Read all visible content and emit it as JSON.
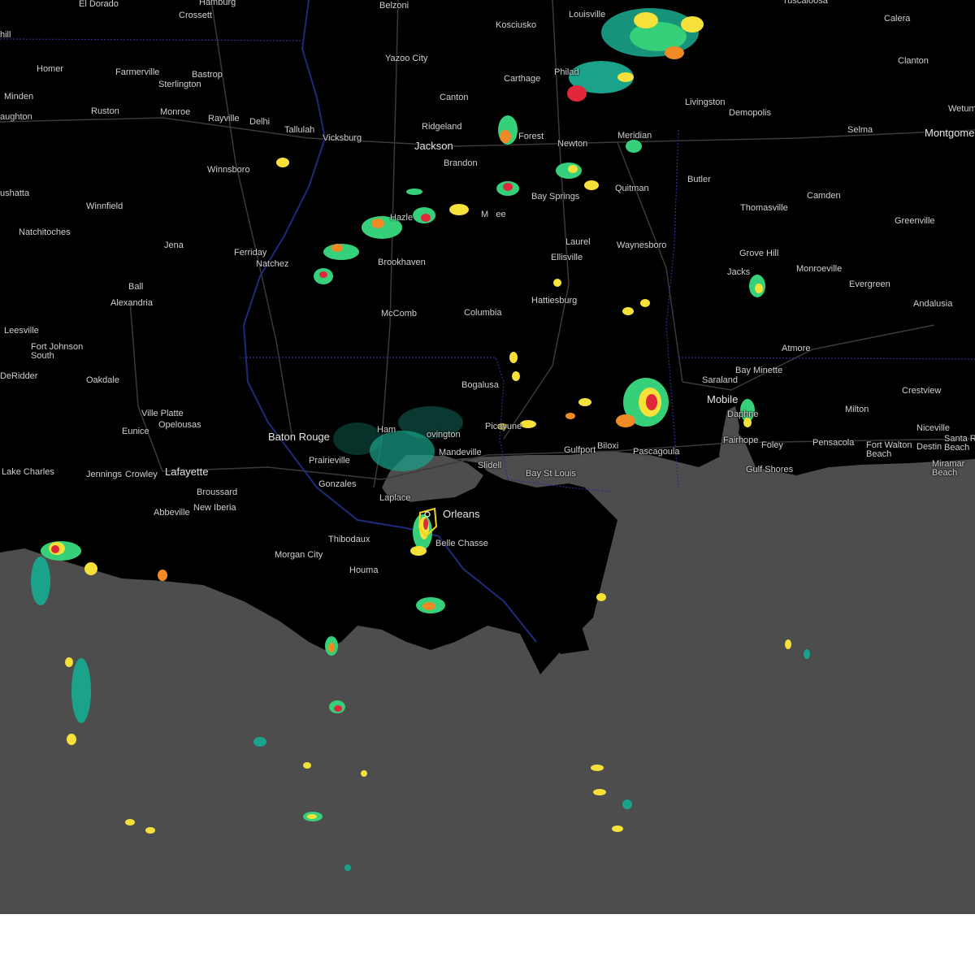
{
  "map": {
    "cities": [
      {
        "id": "el-dorado",
        "name": "El Dorado"
      },
      {
        "id": "hamburg",
        "name": "Hamburg"
      },
      {
        "id": "crossett",
        "name": "Crossett"
      },
      {
        "id": "belzoni",
        "name": "Belzoni"
      },
      {
        "id": "kosciusko",
        "name": "Kosciusko"
      },
      {
        "id": "louisville",
        "name": "Louisville"
      },
      {
        "id": "tuscaloosa",
        "name": "Tuscaloosa"
      },
      {
        "id": "calera",
        "name": "Calera"
      },
      {
        "id": "hill",
        "name": "hill"
      },
      {
        "id": "homer",
        "name": "Homer"
      },
      {
        "id": "farmerville",
        "name": "Farmerville"
      },
      {
        "id": "bastrop",
        "name": "Bastrop"
      },
      {
        "id": "sterlington",
        "name": "Sterlington"
      },
      {
        "id": "yazoo-city",
        "name": "Yazoo City"
      },
      {
        "id": "carthage",
        "name": "Carthage"
      },
      {
        "id": "philadelphia",
        "name": "Philad"
      },
      {
        "id": "livingston",
        "name": "Livingston"
      },
      {
        "id": "demopolis",
        "name": "Demopolis"
      },
      {
        "id": "clanton",
        "name": "Clanton"
      },
      {
        "id": "wetumpka",
        "name": "Wetum"
      },
      {
        "id": "minden",
        "name": "Minden"
      },
      {
        "id": "ruston",
        "name": "Ruston"
      },
      {
        "id": "monroe",
        "name": "Monroe"
      },
      {
        "id": "rayville",
        "name": "Rayville"
      },
      {
        "id": "delhi",
        "name": "Delhi"
      },
      {
        "id": "canton",
        "name": "Canton"
      },
      {
        "id": "aughton",
        "name": "aughton"
      },
      {
        "id": "tallulah",
        "name": "Tallulah"
      },
      {
        "id": "ridgeland",
        "name": "Ridgeland"
      },
      {
        "id": "selma",
        "name": "Selma"
      },
      {
        "id": "montgomery",
        "name": "Montgome"
      },
      {
        "id": "vicksburg",
        "name": "Vicksburg"
      },
      {
        "id": "forest",
        "name": "Forest"
      },
      {
        "id": "meridian",
        "name": "Meridian"
      },
      {
        "id": "jackson",
        "name": "Jackson"
      },
      {
        "id": "newton",
        "name": "Newton"
      },
      {
        "id": "winnsboro",
        "name": "Winnsboro"
      },
      {
        "id": "brandon",
        "name": "Brandon"
      },
      {
        "id": "butler",
        "name": "Butler"
      },
      {
        "id": "quitman",
        "name": "Quitman"
      },
      {
        "id": "bay-springs",
        "name": "Bay Springs"
      },
      {
        "id": "camden",
        "name": "Camden"
      },
      {
        "id": "ushatta",
        "name": "ushatta"
      },
      {
        "id": "winnfield",
        "name": "Winnfield"
      },
      {
        "id": "thomasville",
        "name": "Thomasville"
      },
      {
        "id": "mendenhall",
        "name": "M   ee"
      },
      {
        "id": "hazlehurst",
        "name": "Hazle"
      },
      {
        "id": "greenville",
        "name": "Greenville"
      },
      {
        "id": "natchitoches",
        "name": "Natchitoches"
      },
      {
        "id": "jena",
        "name": "Jena"
      },
      {
        "id": "laurel",
        "name": "Laurel"
      },
      {
        "id": "waynesboro",
        "name": "Waynesboro"
      },
      {
        "id": "ferriday",
        "name": "Ferriday"
      },
      {
        "id": "natchez",
        "name": "Natchez"
      },
      {
        "id": "brookhaven",
        "name": "Brookhaven"
      },
      {
        "id": "ellisville",
        "name": "Ellisville"
      },
      {
        "id": "grove-hill",
        "name": "Grove Hill"
      },
      {
        "id": "jackson-al",
        "name": "Jacks"
      },
      {
        "id": "monroeville",
        "name": "Monroeville"
      },
      {
        "id": "ball",
        "name": "Ball"
      },
      {
        "id": "evergreen",
        "name": "Evergreen"
      },
      {
        "id": "alexandria",
        "name": "Alexandria"
      },
      {
        "id": "hattiesburg",
        "name": "Hattiesburg"
      },
      {
        "id": "andalusia",
        "name": "Andalusia"
      },
      {
        "id": "mccomb",
        "name": "McComb"
      },
      {
        "id": "columbia",
        "name": "Columbia"
      },
      {
        "id": "leesville",
        "name": "Leesville"
      },
      {
        "id": "fort-johnson-south",
        "name": "Fort Johnson\nSouth"
      },
      {
        "id": "atmore",
        "name": "Atmore"
      },
      {
        "id": "bay-minette",
        "name": "Bay Minette"
      },
      {
        "id": "deridder",
        "name": "DeRidder"
      },
      {
        "id": "oakdale",
        "name": "Oakdale"
      },
      {
        "id": "saraland",
        "name": "Saraland"
      },
      {
        "id": "bogalusa",
        "name": "Bogalusa"
      },
      {
        "id": "crestview",
        "name": "Crestview"
      },
      {
        "id": "mobile",
        "name": "Mobile"
      },
      {
        "id": "ville-platte",
        "name": "Ville Platte"
      },
      {
        "id": "milton",
        "name": "Milton"
      },
      {
        "id": "daphne",
        "name": "Daphne"
      },
      {
        "id": "opelousas",
        "name": "Opelousas"
      },
      {
        "id": "hammond",
        "name": "Ham"
      },
      {
        "id": "covington",
        "name": "ovington"
      },
      {
        "id": "picayune",
        "name": "Picayune"
      },
      {
        "id": "eunice",
        "name": "Eunice"
      },
      {
        "id": "niceville",
        "name": "Niceville"
      },
      {
        "id": "baton-rouge",
        "name": "Baton Rouge"
      },
      {
        "id": "mandeville",
        "name": "Mandeville"
      },
      {
        "id": "fairhope",
        "name": "Fairhope"
      },
      {
        "id": "gulfport",
        "name": "Gulfport"
      },
      {
        "id": "biloxi",
        "name": "Biloxi"
      },
      {
        "id": "foley",
        "name": "Foley"
      },
      {
        "id": "pensacola",
        "name": "Pensacola"
      },
      {
        "id": "fort-walton-beach",
        "name": "Fort Walton\nBeach"
      },
      {
        "id": "destin",
        "name": "Destin"
      },
      {
        "id": "santa-rosa-beach",
        "name": "Santa R\nBeach"
      },
      {
        "id": "pascagoula",
        "name": "Pascagoula"
      },
      {
        "id": "prairieville",
        "name": "Prairieville"
      },
      {
        "id": "slidell",
        "name": "Slidell"
      },
      {
        "id": "miramar-beach",
        "name": "Miramar\nBeach"
      },
      {
        "id": "lake-charles",
        "name": "Lake Charles"
      },
      {
        "id": "jennings",
        "name": "Jennings"
      },
      {
        "id": "crowley",
        "name": "Crowley"
      },
      {
        "id": "lafayette",
        "name": "Lafayette"
      },
      {
        "id": "gulf-shores",
        "name": "Gulf Shores"
      },
      {
        "id": "bay-st-louis",
        "name": "Bay St Louis"
      },
      {
        "id": "gonzales",
        "name": "Gonzales"
      },
      {
        "id": "broussard",
        "name": "Broussard"
      },
      {
        "id": "laplace",
        "name": "Laplace"
      },
      {
        "id": "new-iberia",
        "name": "New Iberia"
      },
      {
        "id": "abbeville",
        "name": "Abbeville"
      },
      {
        "id": "new-orleans",
        "name": "Orleans"
      },
      {
        "id": "thibodaux",
        "name": "Thibodaux"
      },
      {
        "id": "belle-chasse",
        "name": "Belle Chasse"
      },
      {
        "id": "morgan-city",
        "name": "Morgan City"
      },
      {
        "id": "houma",
        "name": "Houma"
      }
    ],
    "colors": {
      "land": "#000000",
      "water": "#4d4d4d",
      "roads": "#3a3a3a",
      "state_border": "#2a2f8f",
      "radar_light": "#1aa38a",
      "radar_green": "#36d07a",
      "radar_yellow": "#f5e13a",
      "radar_orange": "#f08a24",
      "radar_red": "#e0283a",
      "warning_polygon": "#f2d21a"
    }
  }
}
